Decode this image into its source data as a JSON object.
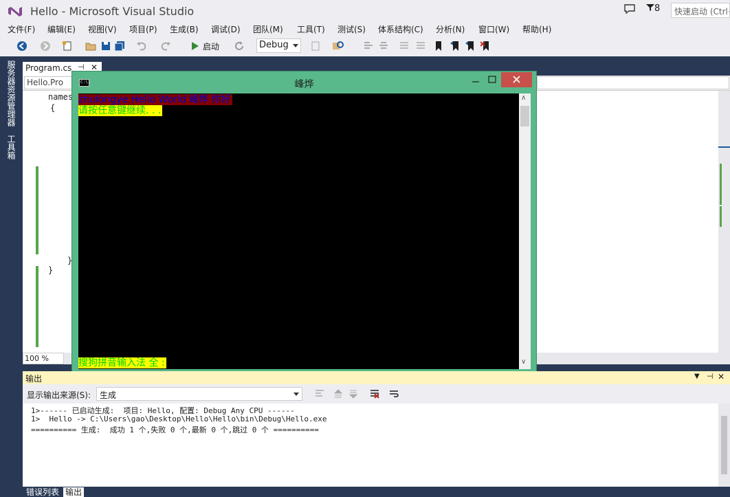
{
  "app": {
    "title": "Hello - Microsoft Visual Studio",
    "notification_count": "8",
    "quick_launch_placeholder": "快速启动 (Ctrl+"
  },
  "menu": [
    "文件(F)",
    "编辑(E)",
    "视图(V)",
    "项目(P)",
    "生成(B)",
    "调试(D)",
    "团队(M)",
    "工具(T)",
    "测试(S)",
    "体系结构(C)",
    "分析(N)",
    "窗口(W)",
    "帮助(H)"
  ],
  "toolbar": {
    "start_label": "启动",
    "config_value": "Debug"
  },
  "side_tabs": [
    "服务器资源管理器",
    "工具箱"
  ],
  "editor": {
    "tab_label": "Program.cs",
    "nav_left": "Hello.Pro",
    "zoom": "100 %",
    "code_fragments": [
      "names",
      "{",
      "}",
      "}"
    ]
  },
  "console": {
    "title": "峰烨",
    "icon_label": "C:\\.",
    "line1": "zhulongye Hello World  峰烨 你好",
    "line2": "请按任意键继续. . .",
    "line3": "搜狗拼音输入法 全 :"
  },
  "output": {
    "title": "输出",
    "source_label": "显示输出来源(S):",
    "source_value": "生成",
    "lines": [
      "1>------ 已启动生成:  项目: Hello, 配置: Debug Any CPU ------",
      "1>  Hello -> C:\\Users\\gao\\Desktop\\Hello\\Hello\\bin\\Debug\\Hello.exe",
      "========== 生成:  成功 1 个,失败 0 个,最新 0 个,跳过 0 个 =========="
    ]
  },
  "bottom_tabs": [
    "错误列表",
    "输出"
  ]
}
